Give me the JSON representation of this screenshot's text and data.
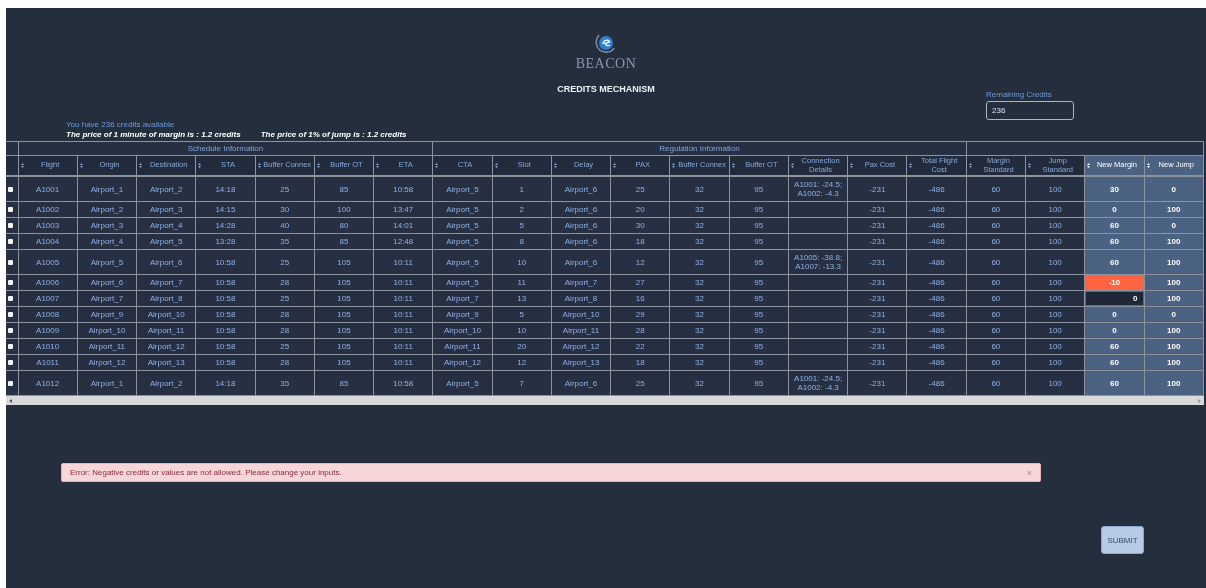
{
  "brand": {
    "name": "BEACON"
  },
  "title": "CREDITS MECHANISM",
  "remaining_credits": {
    "label": "Remaining Credits",
    "value": "236"
  },
  "info": {
    "credits_text": "You have 236 credits available",
    "margin_price": "The price of 1 minute of margin is : 1.2 credits",
    "jump_price": "The price of 1% of jump is : 1.2 credits"
  },
  "table": {
    "groups": [
      {
        "label": "Schedule Information",
        "columns": [
          {
            "label": "Flight",
            "editable": false
          },
          {
            "label": "Origin",
            "editable": false
          },
          {
            "label": "Destination",
            "editable": false
          },
          {
            "label": "STA",
            "editable": false
          },
          {
            "label": "Buffer Connex",
            "editable": false
          },
          {
            "label": "Buffer OT",
            "editable": false
          },
          {
            "label": "ETA",
            "editable": false
          }
        ]
      },
      {
        "label": "Regulation Information",
        "columns": [
          {
            "label": "CTA",
            "editable": false
          },
          {
            "label": "Slot",
            "editable": false
          },
          {
            "label": "Delay",
            "editable": false
          },
          {
            "label": "PAX",
            "editable": false
          },
          {
            "label": "Buffer Connex",
            "editable": false
          },
          {
            "label": "Buffer OT",
            "editable": false
          },
          {
            "label": "Connection Details",
            "editable": false
          },
          {
            "label": "Pax Cost",
            "editable": false
          },
          {
            "label": "Total Flight Cost",
            "editable": false
          }
        ]
      },
      {
        "columns": [
          {
            "label": "Margin Standard",
            "editable": false
          },
          {
            "label": "Jump Standard",
            "editable": false
          },
          {
            "label": "New Margin",
            "editable": true
          },
          {
            "label": "New Jump",
            "editable": true
          }
        ]
      }
    ],
    "rows": [
      {
        "checked": false,
        "cells": [
          "A1001",
          "Airport_1",
          "Airport_2",
          "14:18",
          "25",
          "85",
          "10:58",
          "Airport_5",
          "1",
          "Airport_6",
          "25",
          "32",
          "95",
          "A1001: -24.5; A1002: -4.3",
          "-231",
          "-486",
          "60",
          "100"
        ],
        "inputs": [
          {
            "value": "30",
            "error": false,
            "editing": false
          },
          {
            "value": "0",
            "error": false,
            "editing": false
          }
        ]
      },
      {
        "checked": false,
        "cells": [
          "A1002",
          "Airport_2",
          "Airport_3",
          "14:15",
          "30",
          "100",
          "13:47",
          "Airport_5",
          "2",
          "Airport_6",
          "20",
          "32",
          "95",
          null,
          "-231",
          "-486",
          "60",
          "100"
        ],
        "inputs": [
          {
            "value": "0",
            "error": false,
            "editing": false
          },
          {
            "value": "100",
            "error": false,
            "editing": false
          }
        ]
      },
      {
        "checked": false,
        "cells": [
          "A1003",
          "Airport_3",
          "Airport_4",
          "14:28",
          "40",
          "80",
          "14:01",
          "Airport_5",
          "5",
          "Airport_6",
          "30",
          "32",
          "95",
          null,
          "-231",
          "-486",
          "60",
          "100"
        ],
        "inputs": [
          {
            "value": "60",
            "error": false,
            "editing": false
          },
          {
            "value": "0",
            "error": false,
            "editing": false
          }
        ]
      },
      {
        "checked": false,
        "cells": [
          "A1004",
          "Airport_4",
          "Airport_5",
          "13:28",
          "35",
          "85",
          "12:48",
          "Airport_5",
          "8",
          "Airport_6",
          "18",
          "32",
          "95",
          null,
          "-231",
          "-486",
          "60",
          "100"
        ],
        "inputs": [
          {
            "value": "60",
            "error": false,
            "editing": false
          },
          {
            "value": "100",
            "error": false,
            "editing": false
          }
        ]
      },
      {
        "checked": false,
        "cells": [
          "A1005",
          "Airport_5",
          "Airport_6",
          "10:58",
          "25",
          "105",
          "10:11",
          "Airport_5",
          "10",
          "Airport_6",
          "12",
          "32",
          "95",
          "A1005: -38.8; A1007: -13.3",
          "-231",
          "-486",
          "60",
          "100"
        ],
        "inputs": [
          {
            "value": "60",
            "error": false,
            "editing": false
          },
          {
            "value": "100",
            "error": false,
            "editing": false
          }
        ]
      },
      {
        "checked": false,
        "cells": [
          "A1006",
          "Airport_6",
          "Airport_7",
          "10:58",
          "28",
          "105",
          "10:11",
          "Airport_5",
          "11",
          "Airport_7",
          "27",
          "32",
          "95",
          null,
          "-231",
          "-486",
          "60",
          "100"
        ],
        "inputs": [
          {
            "value": "-10",
            "error": true,
            "editing": false
          },
          {
            "value": "100",
            "error": false,
            "editing": false
          }
        ]
      },
      {
        "checked": false,
        "cells": [
          "A1007",
          "Airport_7",
          "Airport_8",
          "10:58",
          "25",
          "105",
          "10:11",
          "Airport_7",
          "13",
          "Airport_8",
          "16",
          "32",
          "95",
          null,
          "-231",
          "-486",
          "60",
          "100"
        ],
        "inputs": [
          {
            "value": "0",
            "error": false,
            "editing": true
          },
          {
            "value": "100",
            "error": false,
            "editing": false
          }
        ]
      },
      {
        "checked": false,
        "cells": [
          "A1008",
          "Airport_9",
          "Airport_10",
          "10:58",
          "28",
          "105",
          "10:11",
          "Airport_9",
          "5",
          "Airport_10",
          "29",
          "32",
          "95",
          null,
          "-231",
          "-486",
          "60",
          "100"
        ],
        "inputs": [
          {
            "value": "0",
            "error": false,
            "editing": false
          },
          {
            "value": "0",
            "error": false,
            "editing": false
          }
        ]
      },
      {
        "checked": false,
        "cells": [
          "A1009",
          "Airport_10",
          "Airport_11",
          "10:58",
          "28",
          "105",
          "10:11",
          "Airport_10",
          "10",
          "Airport_11",
          "28",
          "32",
          "95",
          null,
          "-231",
          "-486",
          "60",
          "100"
        ],
        "inputs": [
          {
            "value": "0",
            "error": false,
            "editing": false
          },
          {
            "value": "100",
            "error": false,
            "editing": false
          }
        ]
      },
      {
        "checked": false,
        "cells": [
          "A1010",
          "Airport_11",
          "Airport_12",
          "10:58",
          "25",
          "105",
          "10:11",
          "Airport_11",
          "20",
          "Airport_12",
          "22",
          "32",
          "95",
          null,
          "-231",
          "-486",
          "60",
          "100"
        ],
        "inputs": [
          {
            "value": "60",
            "error": false,
            "editing": false
          },
          {
            "value": "100",
            "error": false,
            "editing": false
          }
        ]
      },
      {
        "checked": false,
        "cells": [
          "A1011",
          "Airport_12",
          "Airport_13",
          "10:58",
          "28",
          "105",
          "10:11",
          "Airport_12",
          "12",
          "Airport_13",
          "18",
          "32",
          "95",
          null,
          "-231",
          "-486",
          "60",
          "100"
        ],
        "inputs": [
          {
            "value": "60",
            "error": false,
            "editing": false
          },
          {
            "value": "100",
            "error": false,
            "editing": false
          }
        ]
      },
      {
        "checked": false,
        "cells": [
          "A1012",
          "Airport_1",
          "Airport_2",
          "14:18",
          "35",
          "85",
          "10:58",
          "Airport_5",
          "7",
          "Airport_6",
          "25",
          "32",
          "95",
          "A1001: -24.5; A1002: -4.3",
          "-231",
          "-486",
          "60",
          "100"
        ],
        "inputs": [
          {
            "value": "60",
            "error": false,
            "editing": false
          },
          {
            "value": "100",
            "error": false,
            "editing": false
          }
        ]
      }
    ]
  },
  "alert": {
    "kind": "error",
    "message": "Error: Negative credits or values are not allowed. Please change your inputs.",
    "close": "×"
  },
  "submit": "SUBMIT"
}
